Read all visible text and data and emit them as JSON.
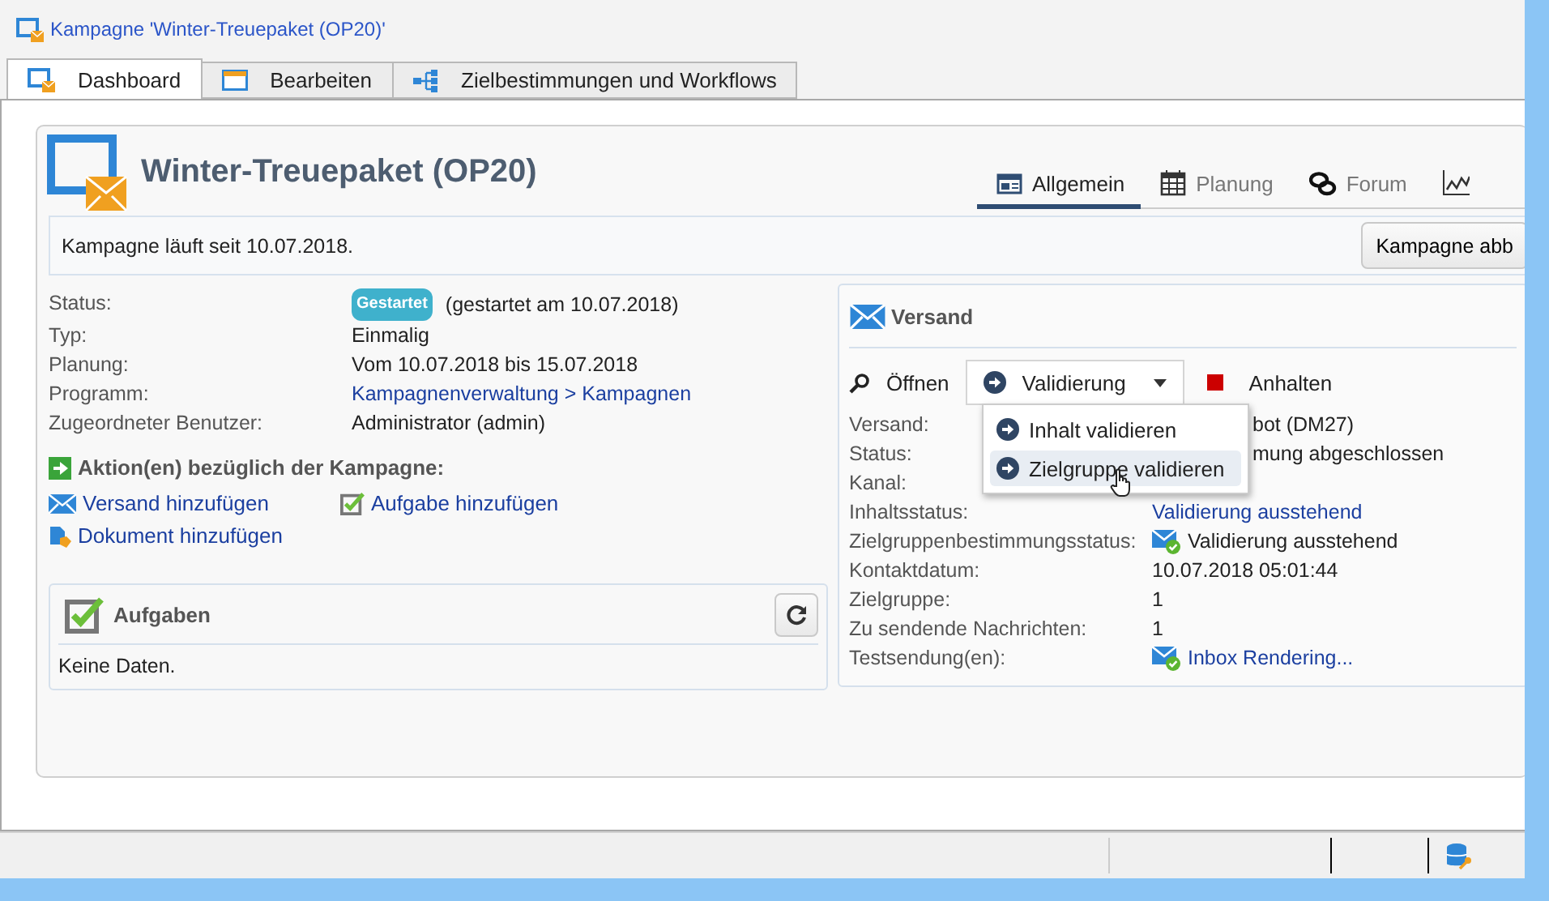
{
  "window": {
    "title": "Kampagne 'Winter-Treuepaket (OP20)'"
  },
  "tabs": [
    {
      "label": "Dashboard",
      "selected": true
    },
    {
      "label": "Bearbeiten",
      "selected": false
    },
    {
      "label": "Zielbestimmungen und Workflows",
      "selected": false
    }
  ],
  "campaign": {
    "title": "Winter-Treuepaket (OP20)",
    "nav": [
      {
        "label": "Allgemein",
        "selected": true
      },
      {
        "label": "Planung",
        "selected": false
      },
      {
        "label": "Forum",
        "selected": false
      },
      {
        "selected": false
      }
    ],
    "info": "Kampagne läuft seit 10.07.2018.",
    "info_button": "Kampagne abb",
    "fields": [
      {
        "label": "Status:",
        "kind": "badge",
        "badge": "Gestartet",
        "value": "(gestartet am 10.07.2018)"
      },
      {
        "label": "Typ:",
        "kind": "text",
        "value": "Einmalig"
      },
      {
        "label": "Planung:",
        "kind": "text",
        "value": "Vom 10.07.2018 bis 15.07.2018"
      },
      {
        "label": "Programm:",
        "kind": "link",
        "value": "Kampagnenverwaltung > Kampagnen"
      },
      {
        "label": "Zugeordneter Benutzer:",
        "kind": "text",
        "value": "Administrator (admin)"
      }
    ],
    "actions_title": "Aktion(en) bezüglich der Kampagne:",
    "actions": [
      {
        "label": "Versand hinzufügen"
      },
      {
        "label": "Aufgabe hinzufügen"
      },
      {
        "label": "Dokument hinzufügen"
      }
    ],
    "tasks": {
      "title": "Aufgaben",
      "empty": "Keine Daten."
    }
  },
  "delivery": {
    "title": "Versand",
    "open": "Öffnen",
    "validate": "Validierung",
    "stop": "Anhalten",
    "menu": [
      {
        "label": "Inhalt validieren",
        "selected": false
      },
      {
        "label": "Zielgruppe validieren",
        "selected": true
      }
    ],
    "fields": [
      {
        "label": "Versand:",
        "kind": "partial",
        "value": "bot (DM27)"
      },
      {
        "label": "Status:",
        "kind": "partial",
        "value": "mung abgeschlossen"
      },
      {
        "label": "Kanal:"
      },
      {
        "label": "Inhaltsstatus:",
        "kind": "link",
        "value": "Validierung ausstehend"
      },
      {
        "label": "Zielgruppenbestimmungsstatus:",
        "kind": "icon-text",
        "value": "Validierung ausstehend"
      },
      {
        "label": "Kontaktdatum:",
        "kind": "text",
        "value": "10.07.2018 05:01:44"
      },
      {
        "label": "Zielgruppe:",
        "kind": "text",
        "value": "1"
      },
      {
        "label": "Zu sendende Nachrichten:",
        "kind": "text",
        "value": "1"
      },
      {
        "label": "Testsendung(en):",
        "kind": "icon-link",
        "value": "Inbox Rendering..."
      }
    ]
  }
}
